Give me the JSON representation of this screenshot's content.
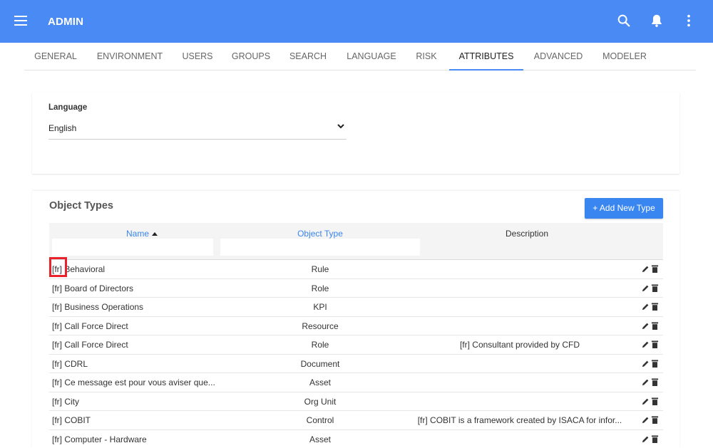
{
  "header": {
    "title": "ADMIN",
    "menu_icon": "hamburger-menu-icon",
    "search_icon": "search-icon",
    "notifications_icon": "bell-icon",
    "more_icon": "more-vertical-icon",
    "bar_color": "#4a8af4"
  },
  "tabs": [
    {
      "label": "GENERAL"
    },
    {
      "label": "ENVIRONMENT"
    },
    {
      "label": "USERS"
    },
    {
      "label": "GROUPS"
    },
    {
      "label": "SEARCH"
    },
    {
      "label": "LANGUAGE"
    },
    {
      "label": "RISK"
    },
    {
      "label": "ATTRIBUTES",
      "active": true
    },
    {
      "label": "ADVANCED"
    },
    {
      "label": "MODELER"
    }
  ],
  "language": {
    "label": "Language",
    "selected": "English"
  },
  "object_types": {
    "title": "Object Types",
    "add_button": "+ Add New Type",
    "columns": {
      "name": "Name",
      "object_type": "Object Type",
      "description": "Description"
    },
    "filters": {
      "name": "",
      "object_type": ""
    },
    "rows": [
      {
        "name": "[fr] Behavioral",
        "type": "Rule",
        "description": ""
      },
      {
        "name": "[fr] Board of Directors",
        "type": "Role",
        "description": ""
      },
      {
        "name": "[fr] Business Operations",
        "type": "KPI",
        "description": ""
      },
      {
        "name": "[fr] Call Force Direct",
        "type": "Resource",
        "description": ""
      },
      {
        "name": "[fr] Call Force Direct",
        "type": "Role",
        "description": "[fr] Consultant provided by CFD"
      },
      {
        "name": "[fr] CDRL",
        "type": "Document",
        "description": ""
      },
      {
        "name": "[fr] Ce message est pour vous aviser que...",
        "type": "Asset",
        "description": ""
      },
      {
        "name": "[fr] City",
        "type": "Org Unit",
        "description": ""
      },
      {
        "name": "[fr] COBIT",
        "type": "Control",
        "description": "[fr] COBIT is a framework created by ISACA for infor..."
      },
      {
        "name": "[fr] Computer - Hardware",
        "type": "Asset",
        "description": ""
      }
    ],
    "row_actions": {
      "edit_icon": "pencil-icon",
      "delete_icon": "trash-icon"
    },
    "highlight_color": "#e8212b"
  }
}
